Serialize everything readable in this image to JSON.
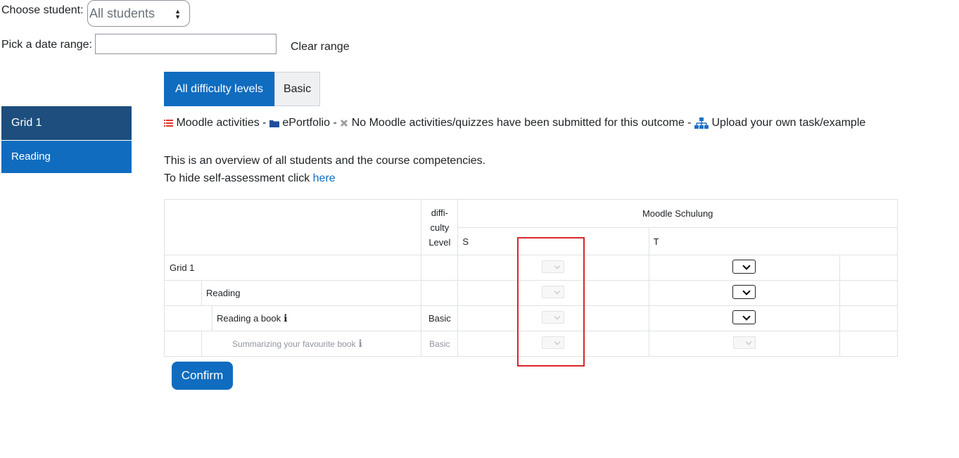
{
  "filters": {
    "student_label": "Choose student:",
    "student_value": "All students",
    "date_label": "Pick a date range:",
    "date_value": "",
    "clear_range": "Clear range"
  },
  "difficulty_tabs": [
    "All difficulty levels",
    "Basic"
  ],
  "nav": {
    "grid": "Grid 1",
    "reading": "Reading"
  },
  "legend": {
    "moodle_activities": "Moodle activities -",
    "eportfolio": "ePortfolio -",
    "no_activities": "No Moodle activities/quizzes have been submitted for this outcome -",
    "upload": "Upload your own task/example"
  },
  "overview": {
    "line1": "This is an overview of all students and the course competencies.",
    "line2_prefix": "To hide self-assessment click",
    "here": "here"
  },
  "table": {
    "diff_header": [
      "diffi-",
      "culty",
      "Level"
    ],
    "course": "Moodle Schulung",
    "col_s": "S",
    "col_t": "T",
    "rows": [
      {
        "name": "Grid 1",
        "level": ""
      },
      {
        "name": "Reading",
        "level": ""
      },
      {
        "name": "Reading a book",
        "level": "Basic"
      },
      {
        "name": "Summarizing your favourite book",
        "level": "Basic"
      }
    ]
  },
  "confirm": "Confirm",
  "colors": {
    "primary": "#0f6cbf",
    "nav_dark": "#1d4e7d",
    "highlight": "#d9262c"
  }
}
